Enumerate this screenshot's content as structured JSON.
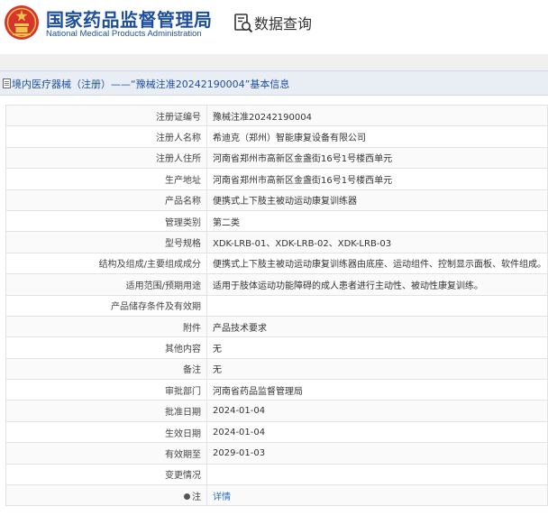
{
  "header": {
    "org_name_cn": "国家药品监督管理局",
    "org_name_en": "National Medical Products Administration",
    "query_title": "数据查询"
  },
  "page_title": "境内医疗器械（注册）——“豫械注准20242190004”基本信息",
  "rows": [
    {
      "label": "注册证编号",
      "value": "豫械注准20242190004"
    },
    {
      "label": "注册人名称",
      "value": "希迪克（郑州）智能康复设备有限公司"
    },
    {
      "label": "注册人住所",
      "value": "河南省郑州市高新区金盏街16号1号楼西单元"
    },
    {
      "label": "生产地址",
      "value": "河南省郑州市高新区金盏街16号1号楼西单元"
    },
    {
      "label": "产品名称",
      "value": "便携式上下肢主被动运动康复训练器"
    },
    {
      "label": "管理类别",
      "value": "第二类"
    },
    {
      "label": "型号规格",
      "value": "XDK-LRB-01、XDK-LRB-02、XDK-LRB-03"
    },
    {
      "label": "结构及组成/主要组成成分",
      "value": "便携式上下肢主被动运动康复训练器由底座、运动组件、控制显示面板、软件组成。"
    },
    {
      "label": "适用范围/预期用途",
      "value": "适用于肢体运动功能障碍的成人患者进行主动性、被动性康复训练。"
    },
    {
      "label": "产品储存条件及有效期",
      "value": ""
    },
    {
      "label": "附件",
      "value": "产品技术要求"
    },
    {
      "label": "其他内容",
      "value": "无"
    },
    {
      "label": "备注",
      "value": "无"
    },
    {
      "label": "审批部门",
      "value": "河南省药品监督管理局"
    },
    {
      "label": "批准日期",
      "value": "2024-01-04"
    },
    {
      "label": "生效日期",
      "value": "2024-01-04"
    },
    {
      "label": "有效期至",
      "value": "2029-01-03"
    },
    {
      "label": "变更情况",
      "value": ""
    }
  ],
  "note_row": {
    "label": "注",
    "link_text": "详情"
  },
  "colors": {
    "brand_blue": "#1d4f9c",
    "title_bg": "#e9eef5",
    "link": "#2b6cc4"
  }
}
